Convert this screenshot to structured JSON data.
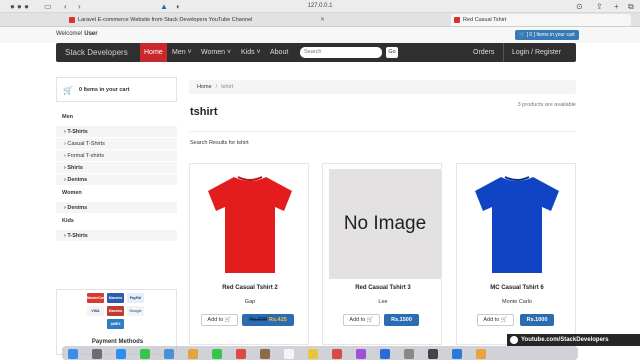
{
  "browser": {
    "url": "127.0.0.1",
    "tabs": [
      {
        "title": "Laravel E-commerce Website from Stack Developers YouTube Channel",
        "active": false
      },
      {
        "title": "Red Casual Tshirt",
        "active": true
      }
    ]
  },
  "topbar": {
    "welcome": "Welcome!",
    "user": "User",
    "cart_button": "[ 0 ] Items in your cart"
  },
  "navbar": {
    "brand": "Stack Developers",
    "items": [
      {
        "label": "Home",
        "active": true
      },
      {
        "label": "Men ˅",
        "active": false
      },
      {
        "label": "Women ˅",
        "active": false
      },
      {
        "label": "Kids ˅",
        "active": false
      },
      {
        "label": "About",
        "active": false
      }
    ],
    "search_placeholder": "Search",
    "go_label": "Go",
    "orders": "Orders",
    "login_register": "Login / Register"
  },
  "sidebar": {
    "cart_label": "0 Items in your cart",
    "categories": [
      {
        "type": "head",
        "label": "Men"
      },
      {
        "type": "item",
        "label": "T-Shirts",
        "bold": true
      },
      {
        "type": "item",
        "label": "Casual T-Shirts",
        "bold": false
      },
      {
        "type": "item",
        "label": "Formal T-shirts",
        "bold": false
      },
      {
        "type": "item",
        "label": "Shirts",
        "bold": true
      },
      {
        "type": "item",
        "label": "Denims",
        "bold": true
      },
      {
        "type": "head",
        "label": "Women"
      },
      {
        "type": "item",
        "label": "Denims",
        "bold": true
      },
      {
        "type": "head",
        "label": "Kids"
      },
      {
        "type": "item",
        "label": "T-Shirts",
        "bold": true
      }
    ],
    "payment_logos": [
      "MasterCard",
      "Maestro",
      "PayPal",
      "VISA",
      "Maestro",
      "Google",
      "AMEX"
    ],
    "payment_label": "Payment Methods"
  },
  "breadcrumb": {
    "home": "Home",
    "separator": "/",
    "current": "tshirt"
  },
  "main": {
    "title": "tshirt",
    "count": "3 products are available",
    "results_label": "Search Results for tshirt"
  },
  "products": [
    {
      "name": "Red Casual Tshirt 2",
      "brand": "Gap",
      "add_label": "Add to 🛒",
      "old_price": "Rs.500",
      "price": "Rs.425",
      "image": "red-tshirt",
      "color": "#e31d1d"
    },
    {
      "name": "Red Casual Tshirt 3",
      "brand": "Lee",
      "add_label": "Add to 🛒",
      "old_price": "",
      "price": "Rs.1500",
      "image": "no-image",
      "no_image_text": "No Image",
      "color": "#e3e1e2"
    },
    {
      "name": "MC Casual Tshirt 6",
      "brand": "Monte Carlo",
      "add_label": "Add to 🛒",
      "old_price": "",
      "price": "Rs.1000",
      "image": "blue-tshirt",
      "color": "#1144c4"
    }
  ],
  "watermark": "Youtube.com/StackDevelopers"
}
